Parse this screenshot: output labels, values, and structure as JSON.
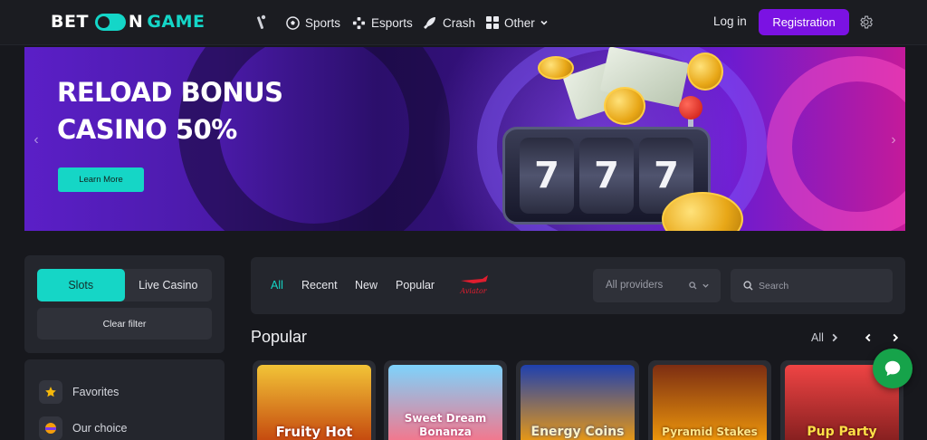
{
  "brand": {
    "part1": "BET",
    "part2": "N",
    "part3": "GAME"
  },
  "nav": {
    "items": [
      {
        "label": "",
        "icon": "cricket-icon"
      },
      {
        "label": "Sports",
        "icon": "soccer-ball-icon"
      },
      {
        "label": "Esports",
        "icon": "gamepad-icon"
      },
      {
        "label": "Crash",
        "icon": "rocket-icon"
      },
      {
        "label": "Other",
        "icon": "grid-icon"
      }
    ],
    "login": "Log in",
    "register": "Registration"
  },
  "banner": {
    "title_line1": "RELOAD BONUS",
    "title_line2": "CASINO 50%",
    "cta": "Learn More",
    "reel_symbol": "7"
  },
  "sidebar": {
    "segments": [
      "Slots",
      "Live Casino"
    ],
    "active_segment": "Slots",
    "clear_filter": "Clear filter",
    "items": [
      {
        "label": "Favorites",
        "icon": "star-icon"
      },
      {
        "label": "Our choice",
        "icon": "badge-icon"
      }
    ]
  },
  "filters": {
    "tabs": [
      "All",
      "Recent",
      "New",
      "Popular"
    ],
    "active_tab": "All",
    "providers_label": "All providers",
    "search_placeholder": "Search",
    "aviator_text": "Aviator"
  },
  "popular": {
    "title": "Popular",
    "all_label": "All",
    "games": [
      {
        "title": "Fruity Hot",
        "bg": "#b8860b"
      },
      {
        "title": "Sweet Dream Bonanza",
        "bg": "#5fb3d9"
      },
      {
        "title": "Energy Coins",
        "bg": "#1e3a8a"
      },
      {
        "title": "Pyramid Stakes",
        "bg": "#7c2d12"
      },
      {
        "title": "Pup Party",
        "bg": "#b91c1c"
      }
    ]
  },
  "colors": {
    "accent": "#15d6c6",
    "register": "#7b12e3",
    "chat": "#16a34a"
  }
}
